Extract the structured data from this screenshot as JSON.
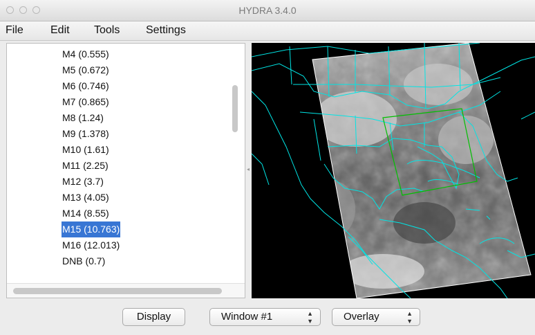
{
  "window": {
    "title": "HYDRA 3.4.0"
  },
  "menu": {
    "items": [
      "File",
      "Edit",
      "Tools",
      "Settings"
    ]
  },
  "bands": [
    {
      "label": "M4 (0.555)"
    },
    {
      "label": "M5 (0.672)"
    },
    {
      "label": "M6 (0.746)"
    },
    {
      "label": "M7 (0.865)"
    },
    {
      "label": "M8 (1.24)"
    },
    {
      "label": "M9 (1.378)"
    },
    {
      "label": "M10 (1.61)"
    },
    {
      "label": "M11 (2.25)"
    },
    {
      "label": "M12 (3.7)"
    },
    {
      "label": "M13 (4.05)"
    },
    {
      "label": "M14 (8.55)"
    },
    {
      "label": "M15 (10.763)",
      "selected": true
    },
    {
      "label": "M16 (12.013)"
    },
    {
      "label": "DNB (0.7)"
    }
  ],
  "controls": {
    "display_label": "Display",
    "window_select": "Window #1",
    "overlay_select": "Overlay"
  },
  "colors": {
    "selection": "#3876d4",
    "map_outline": "#00e5e5",
    "region_box": "#00c000"
  }
}
